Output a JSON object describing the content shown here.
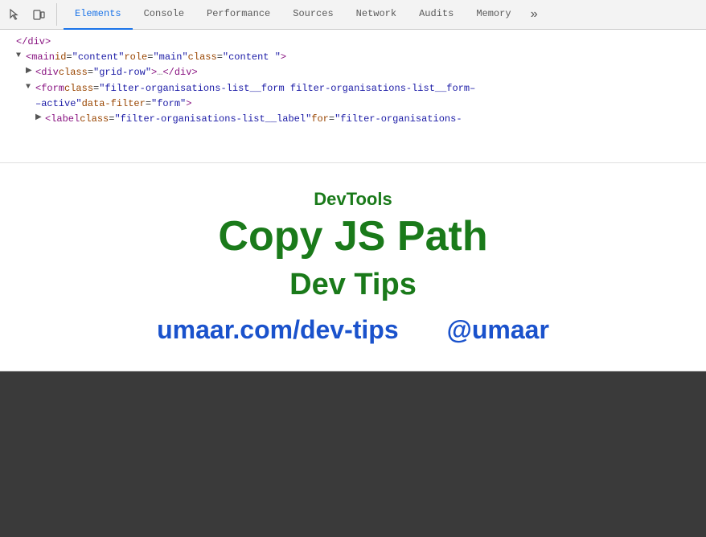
{
  "toolbar": {
    "icons": [
      {
        "name": "cursor-icon",
        "symbol": "⬚"
      },
      {
        "name": "device-icon",
        "symbol": "▭"
      }
    ],
    "tabs": [
      {
        "id": "elements",
        "label": "Elements",
        "active": true
      },
      {
        "id": "console",
        "label": "Console",
        "active": false
      },
      {
        "id": "performance",
        "label": "Performance",
        "active": false
      },
      {
        "id": "sources",
        "label": "Sources",
        "active": false
      },
      {
        "id": "network",
        "label": "Network",
        "active": false
      },
      {
        "id": "audits",
        "label": "Audits",
        "active": false
      },
      {
        "id": "memory",
        "label": "Memory",
        "active": false
      }
    ],
    "more_label": "»"
  },
  "html_tree": {
    "lines": [
      {
        "text": "</div>",
        "indent": 1,
        "prefix": ""
      },
      {
        "tag_open": "<main",
        "attrs": [
          {
            "name": "id",
            "value": "\"content\""
          },
          {
            "name": "role",
            "value": "\"main\""
          },
          {
            "name": "class",
            "value": "\"content \""
          }
        ],
        "tag_close": ">",
        "indent": 1,
        "triangle": "▼"
      },
      {
        "text": "<div class=\"grid-row\">…</div>",
        "indent": 2,
        "triangle": "▶"
      },
      {
        "tag_long": "<form class=\"filter-organisations-list__form filter-organisations-list__form–",
        "indent": 2,
        "triangle": "▼"
      },
      {
        "tag_long2": "–active\" data-filter=\"form\">",
        "indent": 2
      },
      {
        "text": "<label class=\"filter-organisations-list__label\" for=\"filter-organisations-",
        "indent": 3,
        "triangle": "▶"
      }
    ]
  },
  "overlay": {
    "devtools_label": "DevTools",
    "title": "Copy JS Path",
    "subtitle": "Dev Tips",
    "link_url": "umaar.com/dev-tips",
    "link_twitter": "@umaar"
  }
}
